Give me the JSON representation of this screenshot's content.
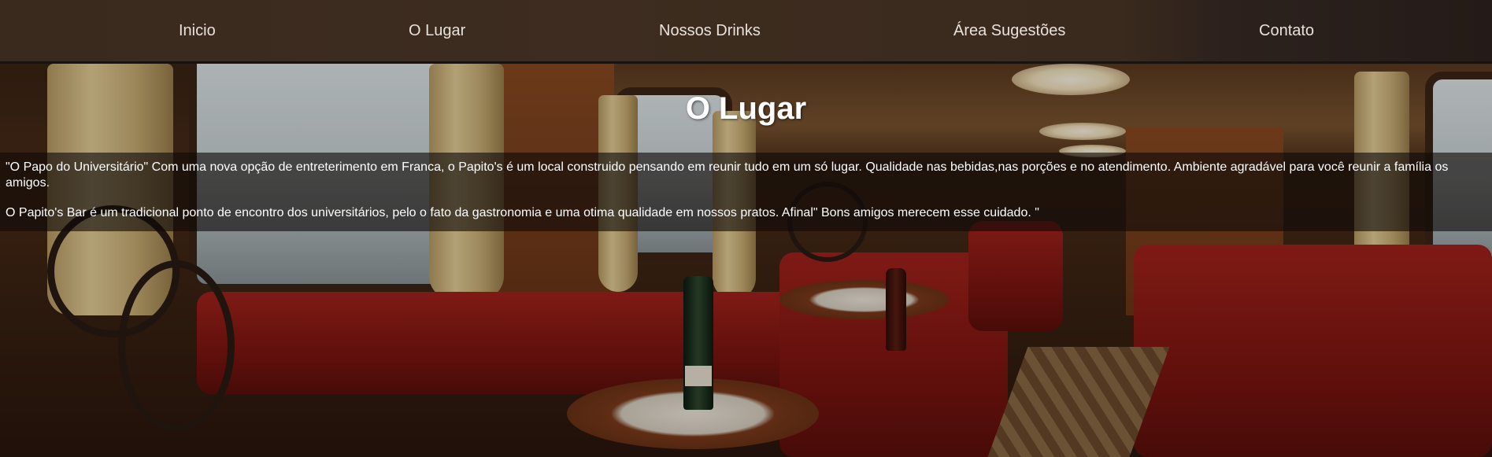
{
  "nav": {
    "items": [
      {
        "label": "Inicio"
      },
      {
        "label": "O Lugar"
      },
      {
        "label": "Nossos Drinks"
      },
      {
        "label": "Área Sugestões"
      },
      {
        "label": "Contato"
      }
    ]
  },
  "main": {
    "title": "O Lugar",
    "paragraphs": [
      "\"O Papo do Universitário\" Com uma nova opção de entreterimento em Franca, o Papito's é um local construido pensando em reunir tudo em um só lugar. Qualidade nas bebidas,nas porções e no atendimento. Ambiente agradável para você reunir a família os amigos.",
      "O Papito's Bar é um tradicional ponto de encontro dos universitários, pelo o fato da gastronomia e uma otima qualidade em nossos pratos. Afinal\" Bons amigos merecem esse cuidado. \""
    ]
  },
  "colors": {
    "nav_background": "#3a2a1e",
    "nav_text": "#e7e2dc",
    "text_band": "rgba(15,10,8,0.62)",
    "title_text": "#ffffff"
  },
  "images": {
    "hero_background": "train-dining-car-photo"
  }
}
